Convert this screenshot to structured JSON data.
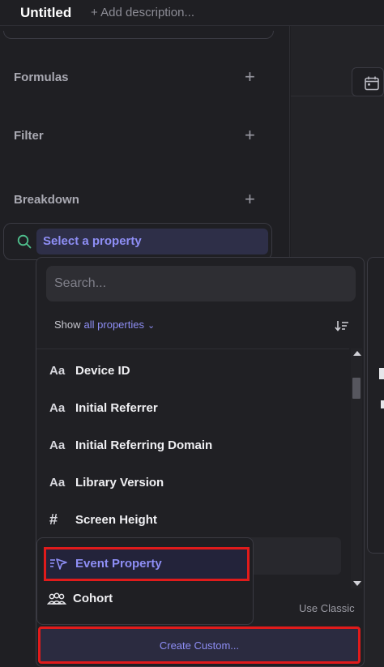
{
  "header": {
    "title": "Untitled",
    "description_placeholder": "+ Add description..."
  },
  "sections": {
    "formulas_label": "Formulas",
    "filter_label": "Filter",
    "breakdown_label": "Breakdown",
    "add_symbol": "+"
  },
  "breakdown_select": {
    "label": "Select a property"
  },
  "dropdown": {
    "search_placeholder": "Search...",
    "show_label": "Show",
    "show_filter": "all properties",
    "properties": [
      {
        "icon": "Aa",
        "label": "Device ID"
      },
      {
        "icon": "Aa",
        "label": "Initial Referrer"
      },
      {
        "icon": "Aa",
        "label": "Initial Referring Domain"
      },
      {
        "icon": "Aa",
        "label": "Library Version"
      },
      {
        "icon": "#",
        "label": "Screen Height"
      }
    ],
    "use_classic": "Use Classic",
    "create_custom": "Create Custom..."
  },
  "submenu": {
    "items": [
      {
        "label": "Event Property",
        "icon": "event-property-icon",
        "selected": true
      },
      {
        "label": "Cohort",
        "icon": "cohort-icon",
        "selected": false
      }
    ]
  },
  "colors": {
    "accent": "#8e8ef5",
    "highlight_box": "#e01b1b",
    "background": "#1f1f23"
  }
}
